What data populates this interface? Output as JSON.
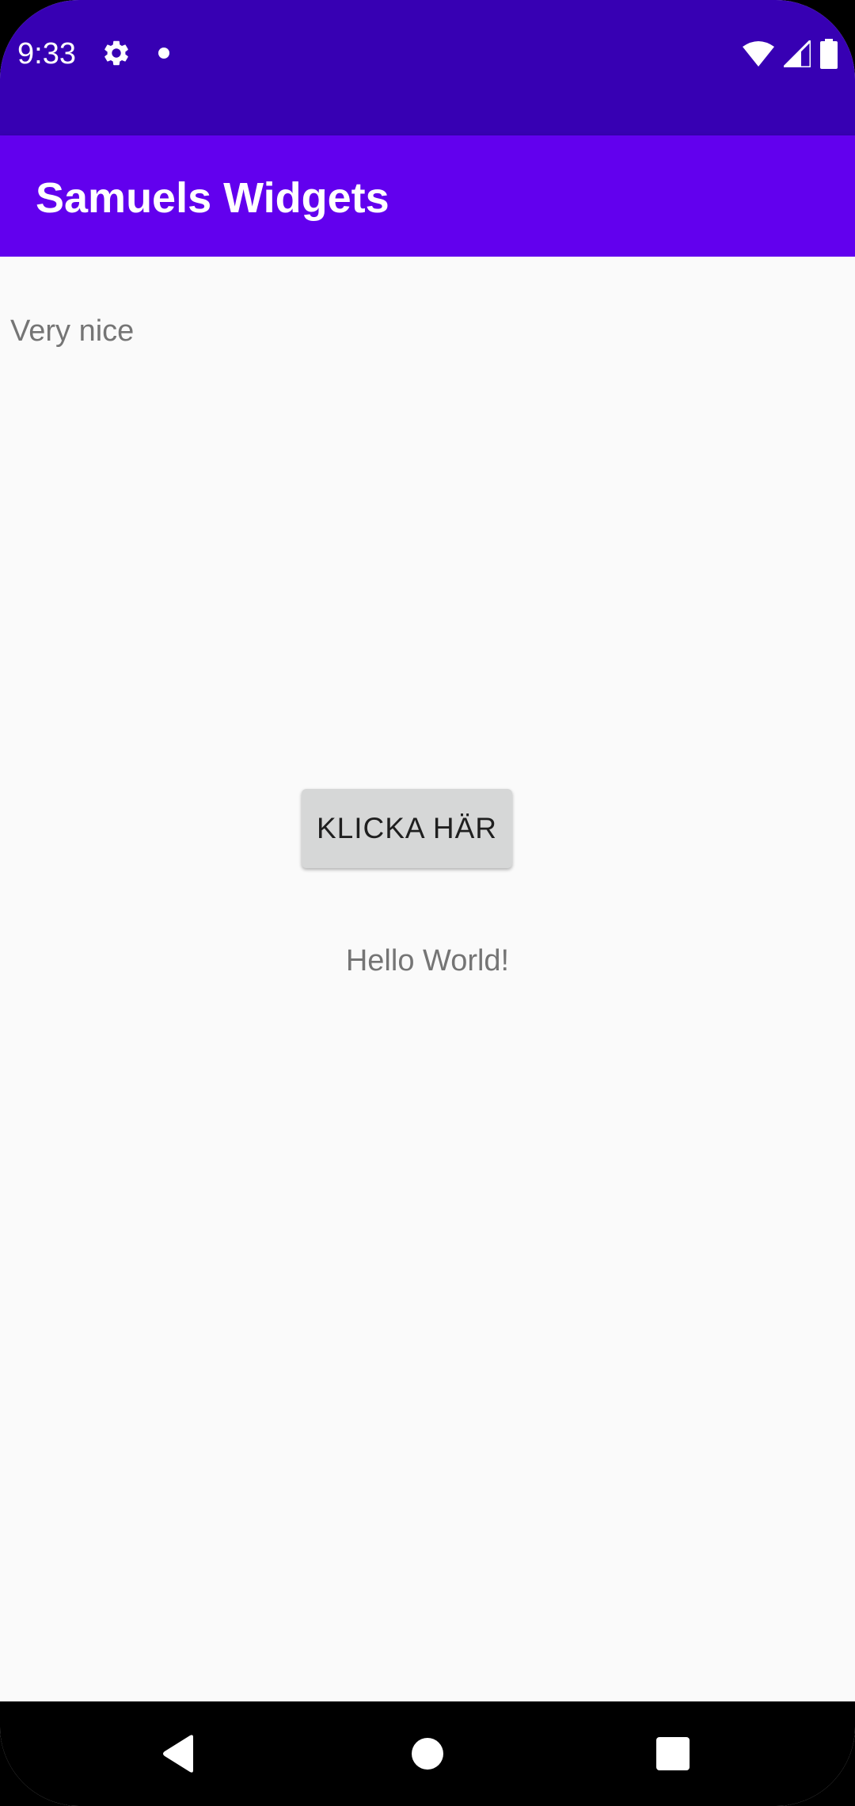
{
  "status_bar": {
    "time": "9:33",
    "icons": [
      "gear-icon",
      "notification-dot-icon",
      "wifi-icon",
      "cellular-signal-icon",
      "battery-icon"
    ],
    "background_color": "#3700b3"
  },
  "app_bar": {
    "title": "Samuels Widgets",
    "background_color": "#6200ee"
  },
  "content": {
    "top_text": "Very nice",
    "button_label": "KLICKA HÄR",
    "hello_text": "Hello World!"
  },
  "nav_bar": {
    "icons": [
      "back-icon",
      "home-icon",
      "recents-icon"
    ]
  }
}
